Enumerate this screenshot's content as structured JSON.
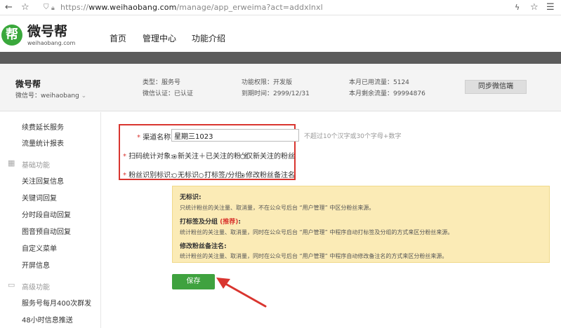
{
  "browser": {
    "url_prefix": "https://",
    "url_host": "www.weihaobang.com",
    "url_path": "/manage/app_erweima?act=addxlnxl"
  },
  "site": {
    "logo_char": "帮",
    "logo_name": "微号帮",
    "logo_domain": "weihaobang.com",
    "nav": [
      "首页",
      "管理中心",
      "功能介绍"
    ]
  },
  "account": {
    "name": "微号帮",
    "wechat_id": "微信号：weihaobang",
    "type": "类型：服务号",
    "auth": "微信认证：已认证",
    "permission": "功能权限：开发版",
    "expire": "到期时间：2999/12/31",
    "used": "本月已用流量：5124",
    "left": "本月剩余流量：99994876",
    "sync_label": "同步微信端"
  },
  "sidebar": {
    "items_top": [
      "续费延长服务",
      "流量统计报表"
    ],
    "group_basic": "基础功能",
    "items_basic": [
      "关注回复信息",
      "关键词回复",
      "分时段自动回复",
      "图音预自动回复",
      "自定义菜单",
      "开屏信息"
    ],
    "group_advanced": "高级功能",
    "items_advanced": [
      "服务号每月400次群发",
      "48小时信息推送"
    ]
  },
  "form": {
    "channel_label": "渠道名称:",
    "channel_value": "星期三1023",
    "channel_hint": "不超过10个汉字或30个字母+数字",
    "scan_label": "扫码统计对象:",
    "scan_options": [
      "新关注＋已关注的粉丝",
      "仅新关注的粉丝"
    ],
    "fans_label": "粉丝识别标识:",
    "fans_options": [
      "无标识",
      "打标签/分组",
      "修改粉丝备注名"
    ],
    "required_mark": "*"
  },
  "notice": {
    "h1": "无标识:",
    "b1": "只统计粉丝的关注量、取消量，不在公众号后台 “用户管理” 中区分粉丝来源。",
    "h2": "打标签及分组",
    "h2_tag": "(推荐)",
    "h2_colon": ":",
    "b2": "统计粉丝的关注量、取消量，同时在公众号后台 “用户管理” 中程序自动打标签及分组的方式来区分粉丝来源。",
    "h3": "修改粉丝备注名:",
    "b3": "统计粉丝的关注量、取消量，同时在公众号后台 “用户管理” 中程序自动修改备注名的方式来区分粉丝来源。"
  },
  "save_label": "保存",
  "colors": {
    "accent_green": "#3fa23f",
    "highlight_red": "#d9352f",
    "notice_bg": "#fbebb6"
  }
}
